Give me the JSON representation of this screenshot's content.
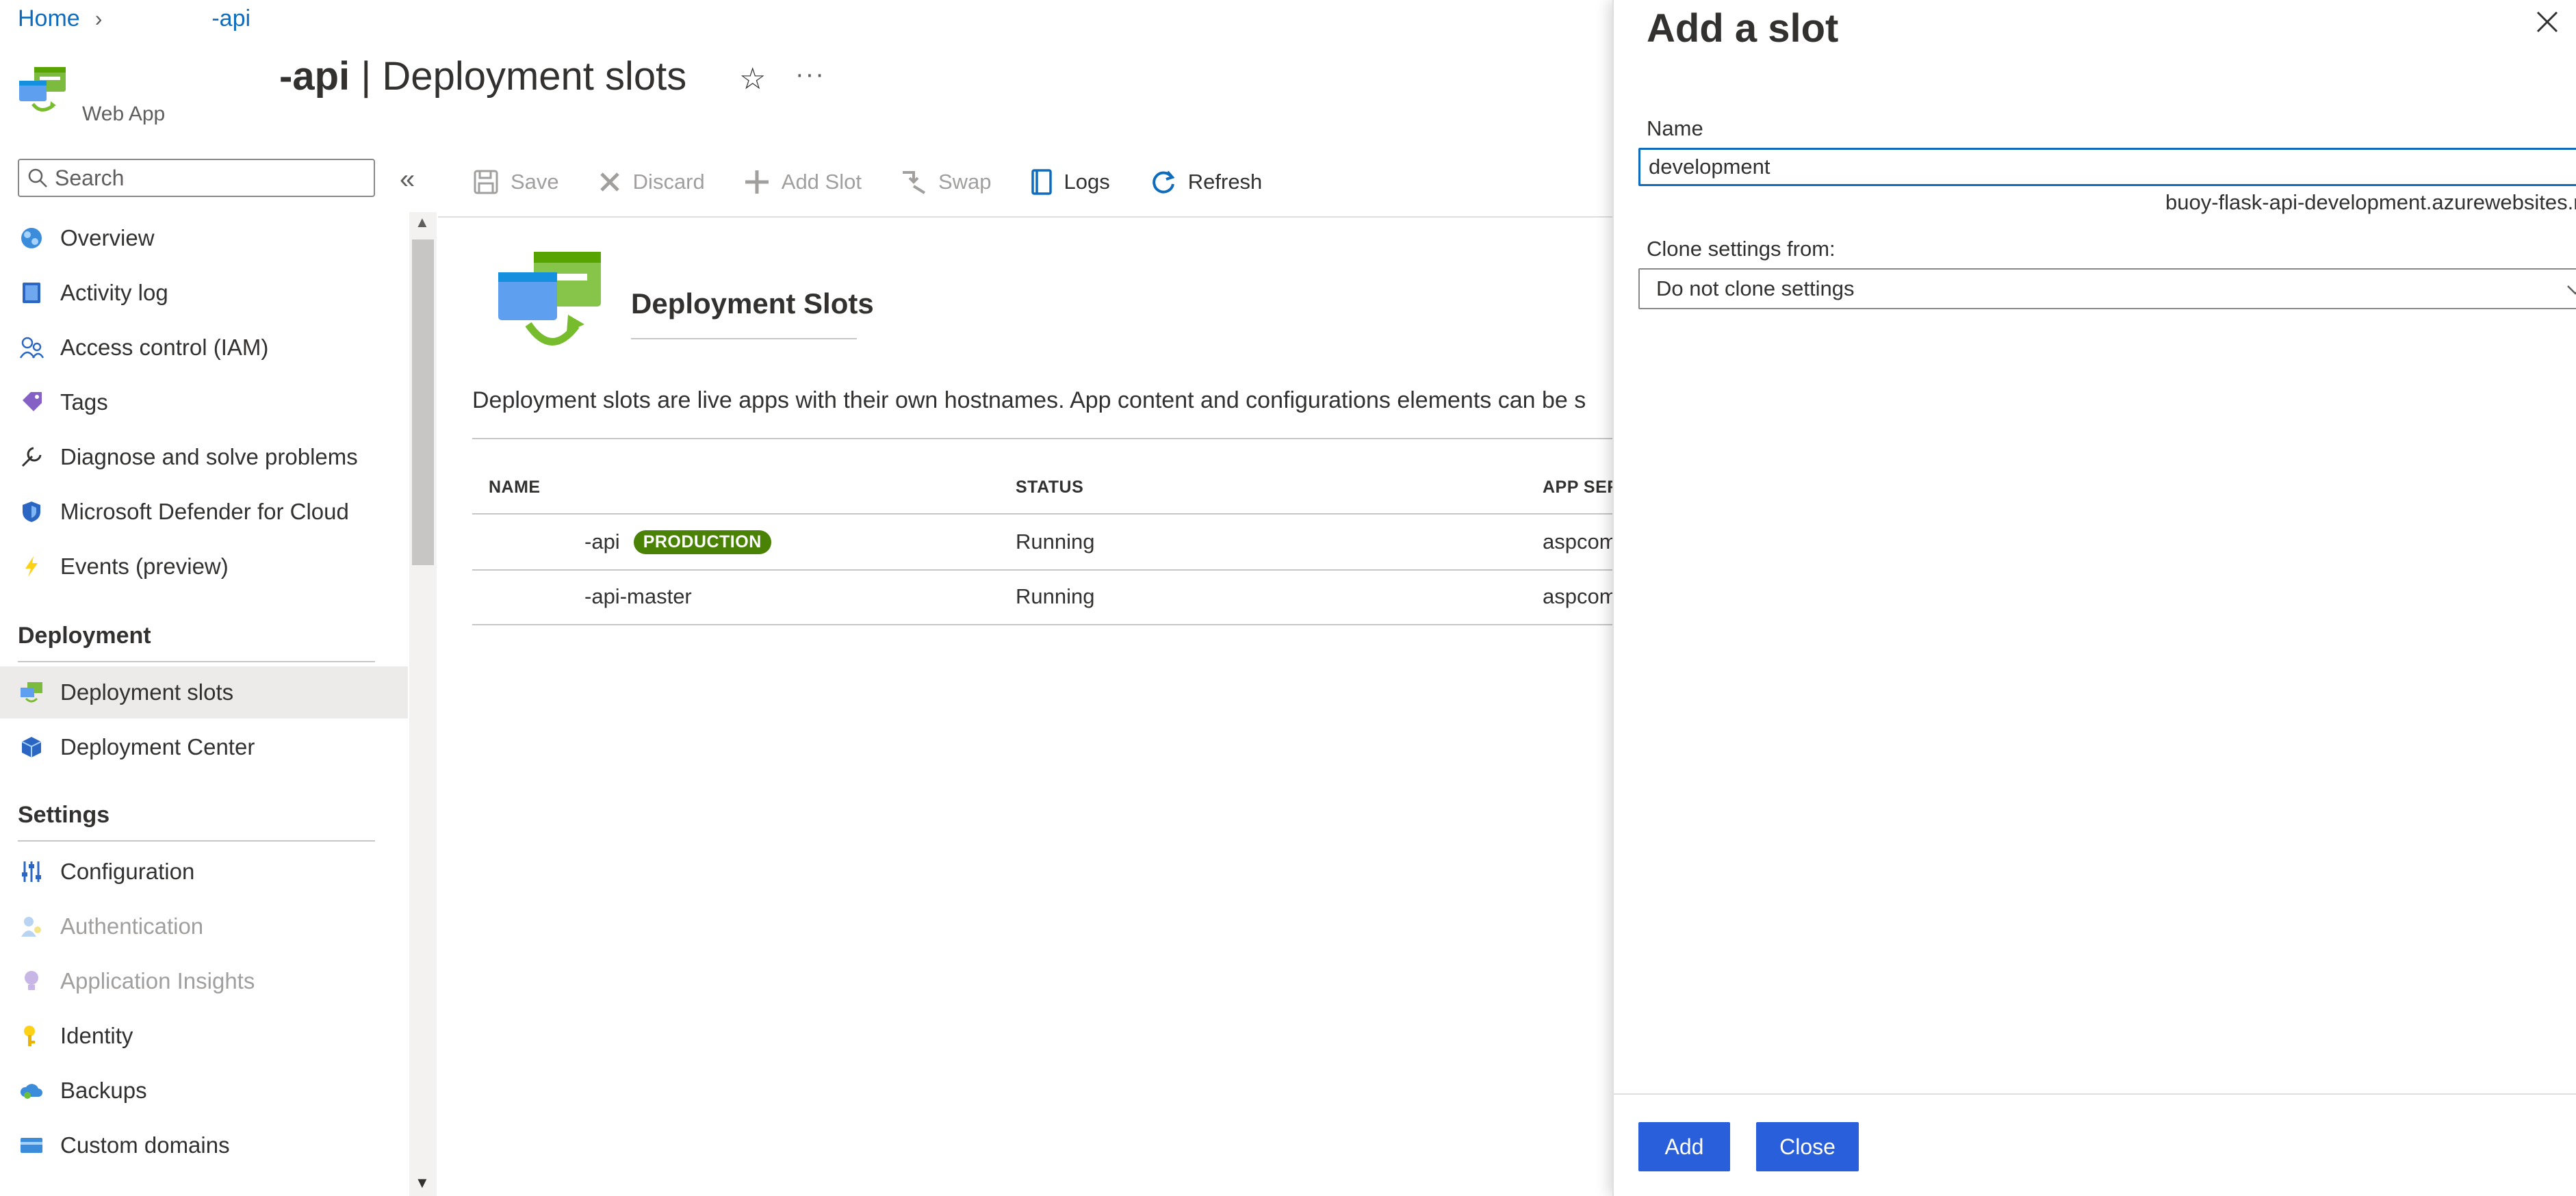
{
  "breadcrumb": {
    "home": "Home",
    "resource": "-api"
  },
  "header": {
    "title_name": "-api",
    "title_sep": " | ",
    "title_page": "Deployment slots",
    "subtitle": "Web App",
    "star": "☆",
    "more": "···"
  },
  "search": {
    "placeholder": "Search"
  },
  "sidebar": {
    "collapse": "«",
    "items": [
      {
        "label": "Overview",
        "icon": "globe-icon"
      },
      {
        "label": "Activity log",
        "icon": "log-book-icon"
      },
      {
        "label": "Access control (IAM)",
        "icon": "people-icon"
      },
      {
        "label": "Tags",
        "icon": "tag-icon"
      },
      {
        "label": "Diagnose and solve problems",
        "icon": "wrench-icon"
      },
      {
        "label": "Microsoft Defender for Cloud",
        "icon": "shield-icon"
      },
      {
        "label": "Events (preview)",
        "icon": "lightning-icon"
      }
    ],
    "sections": [
      {
        "title": "Deployment",
        "items": [
          {
            "label": "Deployment slots",
            "icon": "deployment-slots-icon",
            "active": true
          },
          {
            "label": "Deployment Center",
            "icon": "cube-icon"
          }
        ]
      },
      {
        "title": "Settings",
        "items": [
          {
            "label": "Configuration",
            "icon": "sliders-icon"
          },
          {
            "label": "Authentication",
            "icon": "person-key-icon",
            "disabled": true
          },
          {
            "label": "Application Insights",
            "icon": "lightbulb-icon",
            "disabled": true
          },
          {
            "label": "Identity",
            "icon": "key-icon"
          },
          {
            "label": "Backups",
            "icon": "cloud-backup-icon"
          },
          {
            "label": "Custom domains",
            "icon": "domain-card-icon"
          }
        ]
      }
    ]
  },
  "toolbar": {
    "save": "Save",
    "discard": "Discard",
    "add_slot": "Add Slot",
    "swap": "Swap",
    "logs": "Logs",
    "refresh": "Refresh"
  },
  "content": {
    "heading": "Deployment Slots",
    "description": "Deployment slots are live apps with their own hostnames. App content and configurations elements can be s"
  },
  "table": {
    "headers": [
      "NAME",
      "STATUS",
      "APP SERV"
    ],
    "rows": [
      {
        "name": "-api",
        "badge": "PRODUCTION",
        "status": "Running",
        "plan": "aspcom"
      },
      {
        "name": "-api-master",
        "badge": "",
        "status": "Running",
        "plan": "aspcom"
      }
    ]
  },
  "panel": {
    "title": "Add a slot",
    "name_label": "Name",
    "name_value": "development",
    "hostname_hint": "buoy-flask-api-development.azurewebsites.ne",
    "clone_label": "Clone settings from:",
    "clone_value": "Do not clone settings",
    "add_label": "Add",
    "close_label": "Close"
  },
  "colors": {
    "accent": "#0f6cbd",
    "primary_button": "#2a5fdc",
    "production_badge": "#498205"
  }
}
